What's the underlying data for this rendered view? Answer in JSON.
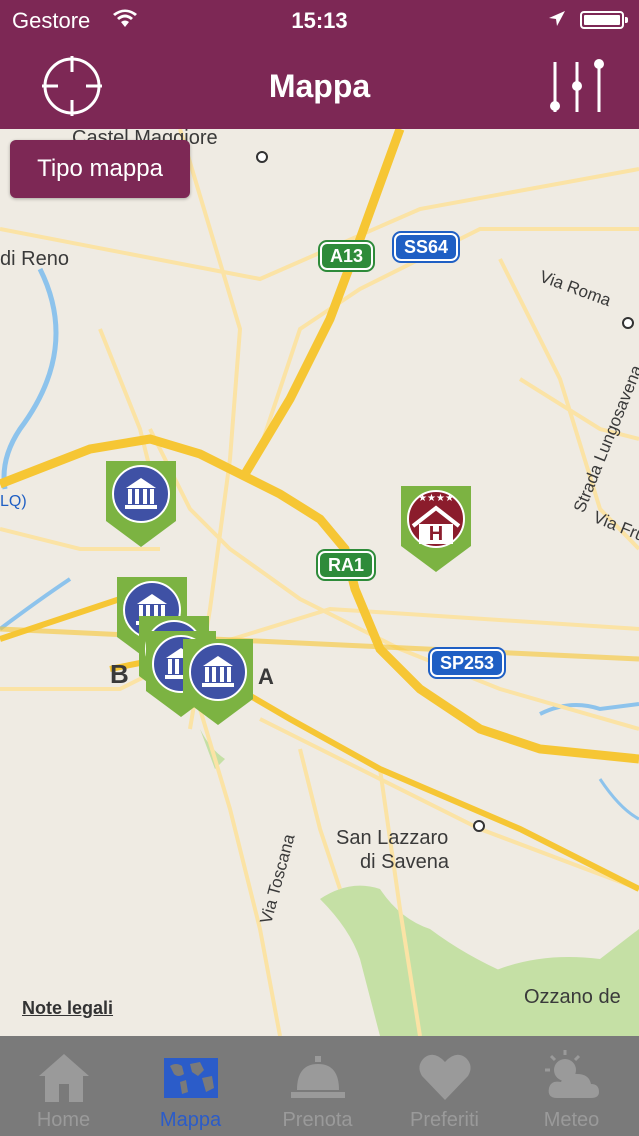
{
  "status_bar": {
    "carrier": "Gestore",
    "time": "15:13"
  },
  "nav": {
    "title": "Mappa"
  },
  "map": {
    "map_type_button": "Tipo mappa",
    "legal_link": "Note legali",
    "labels": {
      "castel_maggiore": "Castel Maggiore",
      "di_reno": "di Reno",
      "via_roma": "Via Roma",
      "strada_lungosavena": "Strada Lungosavena",
      "via_fru": "Via Fru",
      "bologna_b": "B",
      "bologna_a": "A",
      "san_lazzaro": "San Lazzaro",
      "di_savena": "di Savena",
      "via_toscana": "Via Toscana",
      "ozzano": "Ozzano de",
      "lq": "LQ)"
    },
    "shields": {
      "a13": "A13",
      "ss64": "SS64",
      "ra1": "RA1",
      "sp253": "SP253"
    }
  },
  "hotel_pin": {
    "stars": "★★★★",
    "letter": "H"
  },
  "tabs": [
    {
      "label": "Home",
      "icon": "house-icon"
    },
    {
      "label": "Mappa",
      "icon": "world-map-icon"
    },
    {
      "label": "Prenota",
      "icon": "service-bell-icon"
    },
    {
      "label": "Preferiti",
      "icon": "heart-icon"
    },
    {
      "label": "Meteo",
      "icon": "sun-cloud-icon"
    }
  ],
  "colors": {
    "brand": "#7d2855",
    "pin_green": "#7cb342",
    "pin_blue": "#3f51a5",
    "tab_active": "#2b5cc9"
  }
}
